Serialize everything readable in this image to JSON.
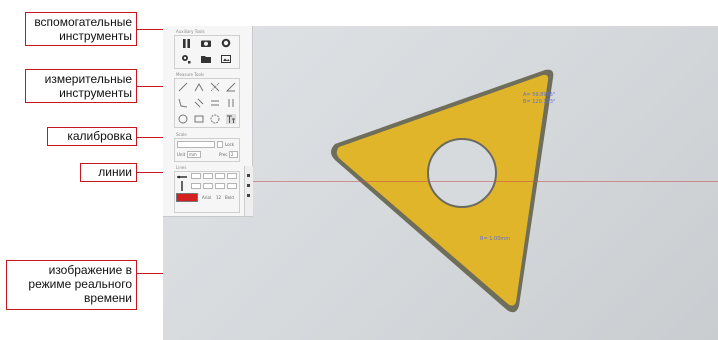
{
  "callouts": {
    "auxiliary": "вспомогательные инструменты",
    "measuring": "измерительные инструменты",
    "calibration": "калибровка",
    "lines": "линии",
    "live_image": "изображение в режиме реального времени"
  },
  "panel": {
    "auxiliary_title": "Auxiliary Tools",
    "measure_title": "Measure Tools",
    "scale_title": "Scale",
    "lines_title": "Lines",
    "lock_label": "Lock",
    "unit_label": "Unit",
    "unit_value": "mm",
    "prec_label": "Prec",
    "prec_value": "2",
    "font_label": "Arial",
    "size_label": "12",
    "style_label": "Bold"
  },
  "readouts": {
    "angle_a": "A= 59.8965°",
    "angle_b": "B= 120.103°",
    "distance": "R= 1.00mm"
  },
  "icons": [
    "pause-icon",
    "camera-icon",
    "color-icon",
    "settings-icon",
    "folder-icon",
    "image-export-icon",
    "line-tool-icon",
    "angle-tool-icon",
    "perpendicular-icon",
    "angle-3pt-icon",
    "polyline-icon",
    "parallel-icon",
    "distance-icon",
    "vertical-distance-icon",
    "circle-tool-icon",
    "rectangle-tool-icon",
    "arc-tool-icon",
    "text-tool-icon"
  ],
  "colors": {
    "accent": "#c8161d",
    "line_color": "#d42020",
    "insert_yellow": "#e2b82a"
  }
}
